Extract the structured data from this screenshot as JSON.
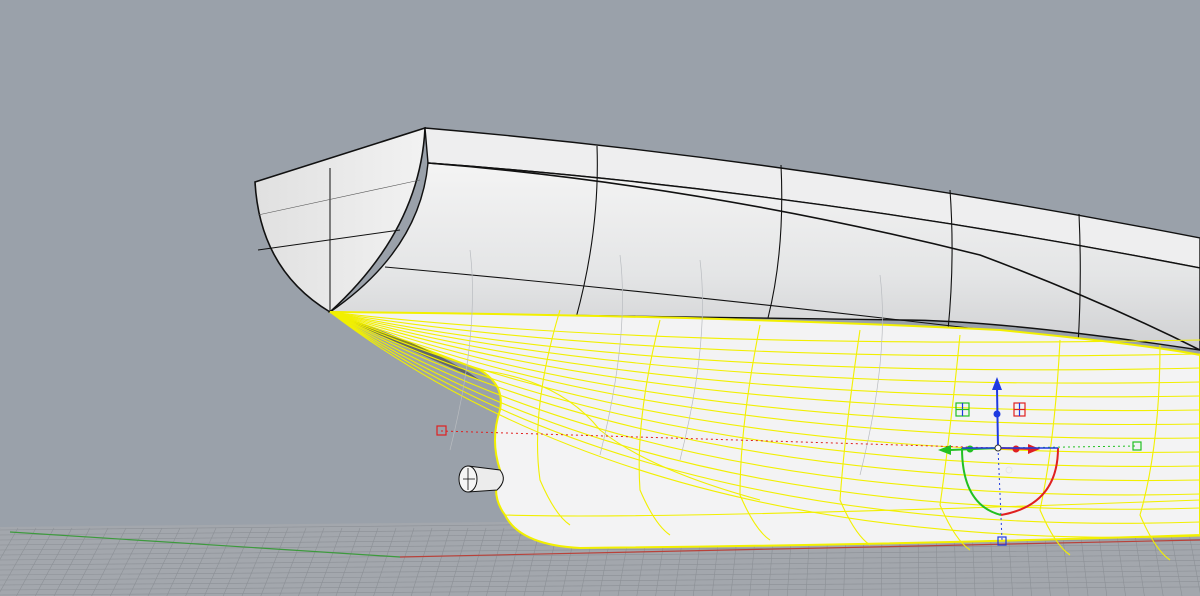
{
  "viewport": {
    "background": "#9aa1aa",
    "grid_color": "#8a8f95",
    "x_axis_color": "#b8423a",
    "y_axis_color": "#3d9a3d"
  },
  "model": {
    "hull_fill": "#e9eaeb",
    "edge_color": "#111111",
    "selection_color": "#f2f000",
    "objects": [
      "ship-hull",
      "bulbous-bow",
      "bow-thruster"
    ]
  },
  "gumball": {
    "x_axis_color": "#e02020",
    "y_axis_color": "#22c022",
    "z_axis_color": "#1e3ae0",
    "handles": [
      "move-x",
      "move-y",
      "move-z",
      "rotate-x",
      "rotate-y",
      "scale-plane-xy"
    ]
  }
}
